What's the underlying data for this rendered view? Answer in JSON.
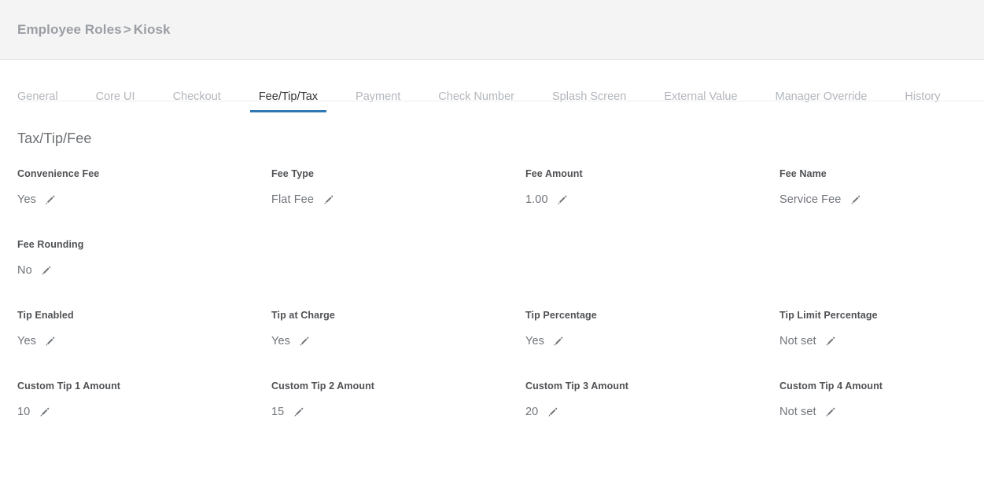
{
  "header": {
    "breadcrumb_parent": "Employee Roles",
    "breadcrumb_separator": ">",
    "breadcrumb_current": "Kiosk"
  },
  "tabs": [
    {
      "label": "General",
      "active": false
    },
    {
      "label": "Core UI",
      "active": false
    },
    {
      "label": "Checkout",
      "active": false
    },
    {
      "label": "Fee/Tip/Tax",
      "active": true
    },
    {
      "label": "Payment",
      "active": false
    },
    {
      "label": "Check Number",
      "active": false
    },
    {
      "label": "Splash Screen",
      "active": false
    },
    {
      "label": "External Value",
      "active": false
    },
    {
      "label": "Manager Override",
      "active": false
    },
    {
      "label": "History",
      "active": false
    }
  ],
  "section": {
    "title": "Tax/Tip/Fee"
  },
  "fields": [
    {
      "label": "Convenience Fee",
      "value": "Yes",
      "icon": "pencil-edit-icon"
    },
    {
      "label": "Fee Type",
      "value": "Flat Fee",
      "icon": "pencil-edit-icon"
    },
    {
      "label": "Fee Amount",
      "value": "1.00",
      "icon": "pencil-edit-icon"
    },
    {
      "label": "Fee Name",
      "value": "Service Fee",
      "icon": "pencil-edit-icon"
    },
    {
      "label": "Fee Rounding",
      "value": "No",
      "icon": "pencil-edit-icon"
    },
    {
      "label": "",
      "value": "",
      "icon": ""
    },
    {
      "label": "",
      "value": "",
      "icon": ""
    },
    {
      "label": "",
      "value": "",
      "icon": ""
    },
    {
      "label": "Tip Enabled",
      "value": "Yes",
      "icon": "pencil-edit-icon"
    },
    {
      "label": "Tip at Charge",
      "value": "Yes",
      "icon": "pencil-edit-icon"
    },
    {
      "label": "Tip Percentage",
      "value": "Yes",
      "icon": "pencil-edit-icon"
    },
    {
      "label": "Tip Limit Percentage",
      "value": "Not set",
      "icon": "pencil-edit-icon"
    },
    {
      "label": "Custom Tip 1 Amount",
      "value": "10",
      "icon": "pencil-edit-icon"
    },
    {
      "label": "Custom Tip 2 Amount",
      "value": "15",
      "icon": "pencil-edit-icon"
    },
    {
      "label": "Custom Tip 3 Amount",
      "value": "20",
      "icon": "pencil-edit-icon"
    },
    {
      "label": "Custom Tip 4 Amount",
      "value": "Not set",
      "icon": "pencil-edit-icon"
    }
  ],
  "colors": {
    "header_background": "#f4f4f5",
    "active_tab_underline": "#2f78b4",
    "active_tab_text": "#333336",
    "inactive_tab_text": "#b2b6bb",
    "label_text": "#4f5154",
    "value_text": "#70747a",
    "breadcrumb_text": "#9a9ea3",
    "section_title_text": "#6d7175",
    "icon": "#6f7378"
  }
}
